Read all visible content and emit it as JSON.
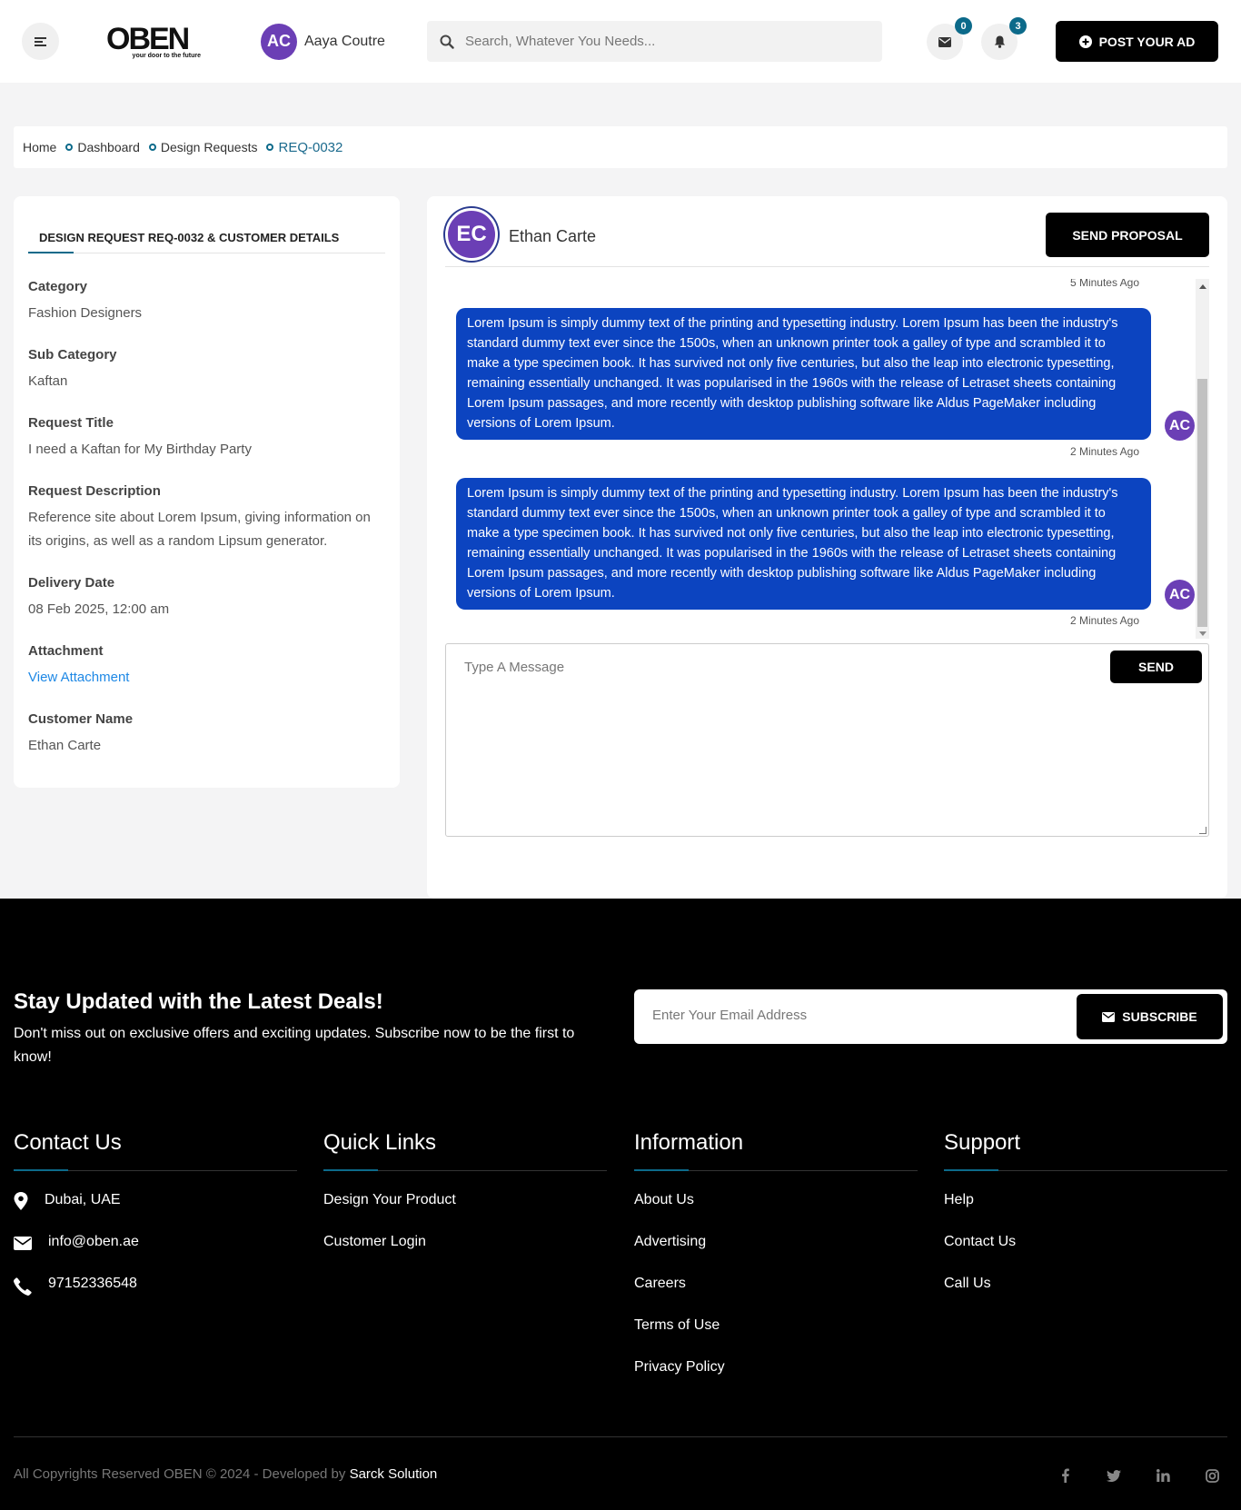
{
  "header": {
    "logo_word": "OBEN",
    "logo_tagline": "your door to the future",
    "user_initials": "AC",
    "user_name": "Aaya Coutre",
    "search_placeholder": "Search, Whatever You Needs...",
    "messages_count": "0",
    "notifications_count": "3",
    "post_ad_label": "POST YOUR AD"
  },
  "breadcrumb": {
    "items": [
      "Home",
      "Dashboard",
      "Design Requests",
      "REQ-0032"
    ]
  },
  "details": {
    "tab_label": "DESIGN REQUEST REQ-0032 & CUSTOMER DETAILS",
    "fields": [
      {
        "label": "Category",
        "value": "Fashion Designers"
      },
      {
        "label": "Sub Category",
        "value": "Kaftan"
      },
      {
        "label": "Request Title",
        "value": "I need a Kaftan for My Birthday Party"
      },
      {
        "label": "Request Description",
        "value": "Reference site about Lorem Ipsum, giving information on its origins, as well as a random Lipsum generator."
      },
      {
        "label": "Delivery Date",
        "value": "08 Feb 2025, 12:00 am"
      },
      {
        "label": "Attachment",
        "value": "View Attachment"
      },
      {
        "label": "Customer Name",
        "value": "Ethan Carte"
      }
    ]
  },
  "chat": {
    "contact_initials": "EC",
    "contact_name": "Ethan Carte",
    "send_proposal_label": "SEND PROPOSAL",
    "top_time": "5 Minutes Ago",
    "messages": [
      {
        "text": "Lorem Ipsum is simply dummy text of the printing and typesetting industry. Lorem Ipsum has been the industry's standard dummy text ever since the 1500s, when an unknown printer took a galley of type and scrambled it to make a type specimen book. It has survived not only five centuries, but also the leap into electronic typesetting, remaining essentially unchanged. It was popularised in the 1960s with the release of Letraset sheets containing Lorem Ipsum passages, and more recently with desktop publishing software like Aldus PageMaker including versions of Lorem Ipsum.",
        "sender_initials": "AC",
        "time": "2 Minutes Ago"
      },
      {
        "text": "Lorem Ipsum is simply dummy text of the printing and typesetting industry. Lorem Ipsum has been the industry's standard dummy text ever since the 1500s, when an unknown printer took a galley of type and scrambled it to make a type specimen book. It has survived not only five centuries, but also the leap into electronic typesetting, remaining essentially unchanged. It was popularised in the 1960s with the release of Letraset sheets containing Lorem Ipsum passages, and more recently with desktop publishing software like Aldus PageMaker including versions of Lorem Ipsum.",
        "sender_initials": "AC",
        "time": "2 Minutes Ago"
      }
    ],
    "input_placeholder": "Type A Message",
    "send_label": "SEND"
  },
  "footer": {
    "newsletter_title": "Stay Updated with the Latest Deals!",
    "newsletter_text": "Don't miss out on exclusive offers and exciting updates. Subscribe now to be the first to know!",
    "email_placeholder": "Enter Your Email Address",
    "subscribe_label": "SUBSCRIBE",
    "contact": {
      "title": "Contact Us",
      "address": "Dubai, UAE",
      "email": "info@oben.ae",
      "phone": "97152336548"
    },
    "quick_links": {
      "title": "Quick Links",
      "items": [
        "Design Your Product",
        "Customer Login"
      ]
    },
    "information": {
      "title": "Information",
      "items": [
        "About Us",
        "Advertising",
        "Careers",
        "Terms of Use",
        "Privacy Policy"
      ]
    },
    "support": {
      "title": "Support",
      "items": [
        "Help",
        "Contact Us",
        "Call Us"
      ]
    },
    "copyright_text": "All Copyrights Reserved OBEN © 2024 - Developed by",
    "developer": "Sarck Solution",
    "social_icons": [
      "facebook-icon",
      "twitter-icon",
      "linkedin-icon",
      "instagram-icon"
    ]
  },
  "colors": {
    "accent": "#0c6a8a",
    "bubble": "#0c44c0",
    "avatar": "#6b3fb5",
    "link": "#1e88e5"
  }
}
